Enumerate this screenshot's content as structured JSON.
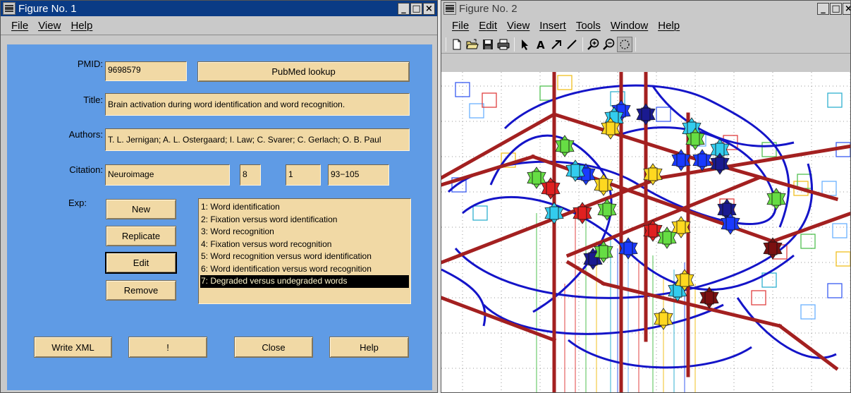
{
  "window1": {
    "title": "Figure No. 1",
    "menu": [
      "File",
      "View",
      "Help"
    ],
    "form": {
      "pmid_label": "PMID:",
      "pmid_value": "9698579",
      "pubmed_button": "PubMed lookup",
      "title_label": "Title:",
      "title_value": "Brain activation during word identification and word recognition.",
      "authors_label": "Authors:",
      "authors_value": "T. L. Jernigan; A. L. Ostergaard; I. Law; C. Svarer; C. Gerlach; O. B. Paul",
      "citation_label": "Citation:",
      "citation_journal": "Neuroimage",
      "citation_volume": "8",
      "citation_issue": "1",
      "citation_pages": "93−105",
      "exp_label": "Exp:"
    },
    "exp_buttons": {
      "new": "New",
      "replicate": "Replicate",
      "edit": "Edit",
      "remove": "Remove"
    },
    "experiments": [
      "1: Word identification",
      "2: Fixation versus word identification",
      "3: Word recognition",
      "4: Fixation versus word recognition",
      "5: Word recognition versus word identification",
      "6: Word identification versus word recognition",
      "7: Degraded versus undegraded words"
    ],
    "selected_experiment_index": 6,
    "bottom_buttons": {
      "write_xml": "Write XML",
      "bang": "!",
      "close": "Close",
      "help": "Help"
    }
  },
  "window2": {
    "title": "Figure No. 2",
    "menu": [
      "File",
      "Edit",
      "View",
      "Insert",
      "Tools",
      "Window",
      "Help"
    ],
    "toolbar": [
      "new-file-icon",
      "open-folder-icon",
      "save-icon",
      "print-icon",
      "select-arrow-icon",
      "text-insert-icon",
      "arrow-insert-icon",
      "line-insert-icon",
      "zoom-in-icon",
      "zoom-out-icon",
      "rotate-3d-icon"
    ]
  },
  "window_buttons": {
    "minimize": "_",
    "maximize": "□",
    "close": "×"
  },
  "colors": {
    "panel_bg": "#5f9be5",
    "field_bg": "#f1d9a5",
    "titlebar_active": "#0a3b85",
    "plot_rod": "#a32020",
    "plot_curve": "#1414c8"
  }
}
